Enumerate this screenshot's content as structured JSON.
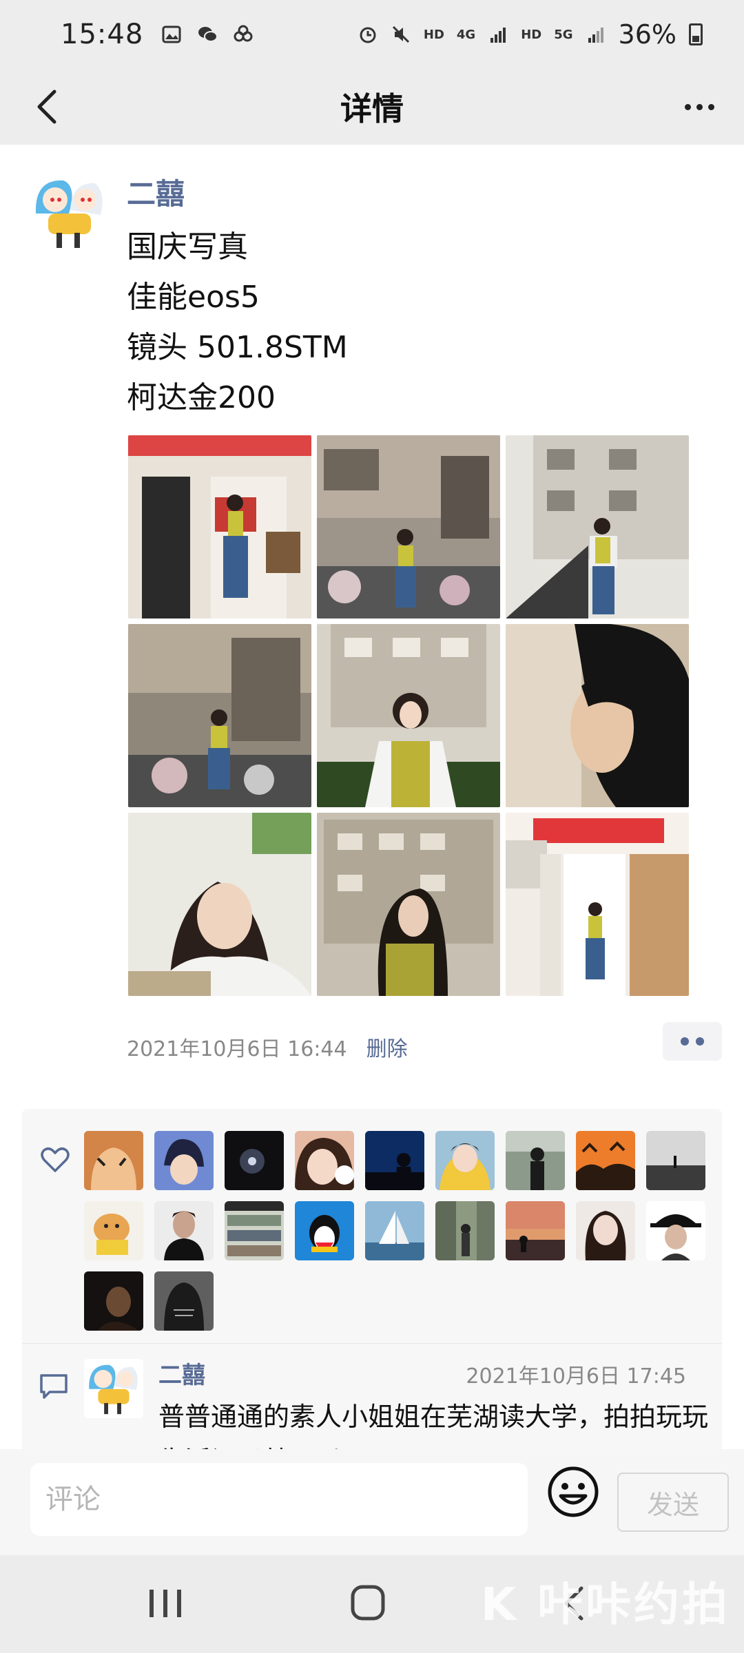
{
  "status_bar": {
    "time": "15:48",
    "battery": "36%",
    "network_labels": [
      "HD",
      "4G",
      "HD",
      "5G"
    ]
  },
  "header": {
    "title": "详情"
  },
  "post": {
    "author": "二囍",
    "lines": [
      "国庆写真",
      "佳能eos5",
      "镜头 501.8STM",
      "柯达金200"
    ],
    "photos_count": 9,
    "timestamp": "2021年10月6日 16:44",
    "delete_label": "删除"
  },
  "likes": {
    "count": 20
  },
  "comments": [
    {
      "author": "二囍",
      "time": "2021年10月6日 17:45",
      "text": "普普通通的素人小姐姐在芜湖读大学，拍拍玩玩生活记录就可以了"
    }
  ],
  "input": {
    "placeholder": "评论",
    "send_label": "发送"
  },
  "watermark": "K 咔咔约拍",
  "colors": {
    "link": "#576b95",
    "bar_bg": "#ededed"
  }
}
